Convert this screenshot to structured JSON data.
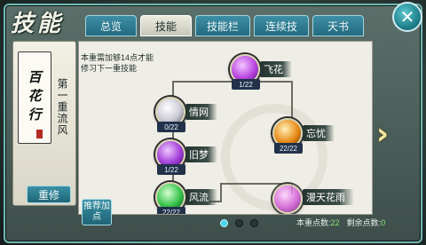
{
  "window": {
    "title": "技能"
  },
  "tabs": [
    {
      "label": "总览",
      "active": false
    },
    {
      "label": "技能",
      "active": true
    },
    {
      "label": "技能栏",
      "active": false
    },
    {
      "label": "连续技",
      "active": false
    },
    {
      "label": "天书",
      "active": false
    }
  ],
  "close": {
    "icon": "close-icon"
  },
  "school": {
    "name": "百花行",
    "style_label": "第一重流风",
    "reset_label": "重修"
  },
  "tree": {
    "hint": "本重需加够14点才能修习下一重技能",
    "nodes": [
      {
        "name": "飞花",
        "level": "1/22",
        "color": "#b743e0"
      },
      {
        "name": "情网",
        "level": "0/22",
        "color": "#c9c9d6"
      },
      {
        "name": "忘忧",
        "level": "22/22",
        "color": "#e88a16"
      },
      {
        "name": "旧梦",
        "level": "1/22",
        "color": "#a03cd8"
      },
      {
        "name": "风流",
        "level": "22/22",
        "color": "#35c24a"
      },
      {
        "name": "漫天花雨",
        "level": "",
        "color": "#d25ad6"
      }
    ]
  },
  "footer": {
    "recommend_label": "推荐加点",
    "page_dots": 3,
    "active_page": 1,
    "points_this_level_label": "本重点数",
    "points_this_level_value": "22",
    "points_remaining_label": "剩余点数",
    "points_remaining_value": "0"
  },
  "next": {
    "icon": "chevron-right-icon"
  },
  "colors": {
    "accent": "#3a8fa4",
    "panel": "#efeee6",
    "active_dot": "#4cd7ea"
  }
}
